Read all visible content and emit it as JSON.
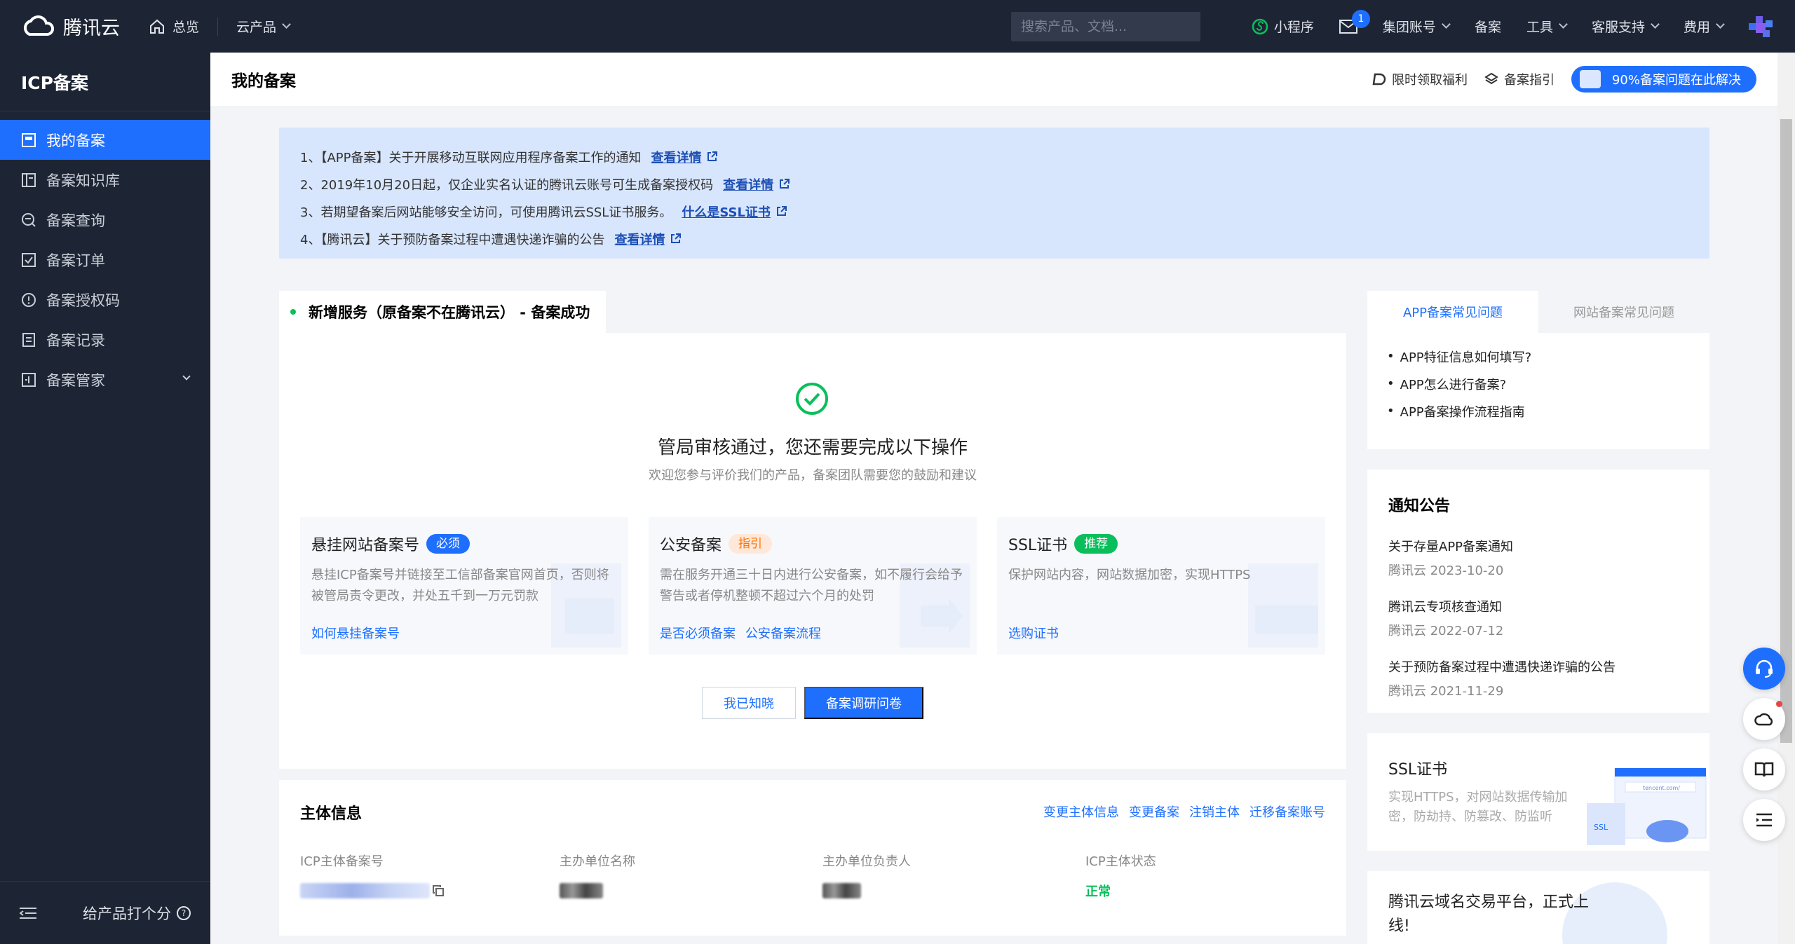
{
  "topbar": {
    "brand": "腾讯云",
    "overview": "总览",
    "products": "云产品",
    "search_placeholder": "搜索产品、文档...",
    "mini_program": "小程序",
    "mail_badge": "1",
    "group_account": "集团账号",
    "beian": "备案",
    "tools": "工具",
    "support": "客服支持",
    "billing": "费用"
  },
  "sidebar": {
    "title": "ICP备案",
    "items": [
      {
        "label": "我的备案",
        "icon": "my-beian-icon"
      },
      {
        "label": "备案知识库",
        "icon": "knowledge-icon"
      },
      {
        "label": "备案查询",
        "icon": "query-icon"
      },
      {
        "label": "备案订单",
        "icon": "order-icon"
      },
      {
        "label": "备案授权码",
        "icon": "auth-code-icon"
      },
      {
        "label": "备案记录",
        "icon": "record-icon"
      },
      {
        "label": "备案管家",
        "icon": "manager-icon"
      }
    ],
    "footer_rate": "给产品打个分",
    "footer_rate_icon": "?"
  },
  "header": {
    "title": "我的备案",
    "link_benefit": "限时领取福利",
    "link_guide": "备案指引",
    "promo": "90%备案问题在此解决"
  },
  "notice": {
    "lines": [
      {
        "text": "1、【APP备案】关于开展移动互联网应用程序备案工作的通知",
        "link": "查看详情"
      },
      {
        "text": "2、2019年10月20日起，仅企业实名认证的腾讯云账号可生成备案授权码",
        "link": "查看详情"
      },
      {
        "text": "3、若期望备案后网站能够安全访问，可使用腾讯云SSL证书服务。",
        "link": "什么是SSL证书"
      },
      {
        "text": "4、【腾讯云】关于预防备案过程中遭遇快递诈骗的公告",
        "link": "查看详情"
      }
    ]
  },
  "success": {
    "tab_title": "新增服务（原备案不在腾讯云） - 备案成功",
    "title": "管局审核通过，您还需要完成以下操作",
    "subtitle": "欢迎您参与评价我们的产品，备案团队需要您的鼓励和建议",
    "tasks": [
      {
        "title": "悬挂网站备案号",
        "tag": "必须",
        "desc": "悬挂ICP备案号并链接至工信部备案官网首页，否则将被管局责令更改，并处五千到一万元罚款",
        "links": [
          "如何悬挂备案号"
        ]
      },
      {
        "title": "公安备案",
        "tag": "指引",
        "desc": "需在服务开通三十日内进行公安备案，如不履行会给予警告或者停机整顿不超过六个月的处罚",
        "links": [
          "是否必须备案",
          "公安备案流程"
        ]
      },
      {
        "title": "SSL证书",
        "tag": "推荐",
        "desc": "保护网站内容，网站数据加密，实现HTTPS",
        "links": [
          "选购证书"
        ]
      }
    ],
    "btn_ack": "我已知晓",
    "btn_survey": "备案调研问卷"
  },
  "subject": {
    "title": "主体信息",
    "actions": [
      "变更主体信息",
      "变更备案",
      "注销主体",
      "迁移备案账号"
    ],
    "fields": [
      {
        "label": "ICP主体备案号"
      },
      {
        "label": "主办单位名称"
      },
      {
        "label": "主办单位负责人"
      },
      {
        "label": "ICP主体状态",
        "value": "正常"
      }
    ]
  },
  "faq": {
    "tab_app": "APP备案常见问题",
    "tab_web": "网站备案常见问题",
    "items": [
      "APP特征信息如何填写?",
      "APP怎么进行备案?",
      "APP备案操作流程指南"
    ]
  },
  "announcements": {
    "title": "通知公告",
    "items": [
      {
        "title": "关于存量APP备案通知",
        "meta": "腾讯云 2023-10-20"
      },
      {
        "title": "腾讯云专项核查通知",
        "meta": "腾讯云 2022-07-12"
      },
      {
        "title": "关于预防备案过程中遭遇快递诈骗的公告",
        "meta": "腾讯云 2021-11-29"
      }
    ]
  },
  "ssl_promo": {
    "title": "SSL证书",
    "desc": "实现HTTPS，对网站数据传输加密，防劫持、防篡改、防监听",
    "art_url": "tencent.com/",
    "art_label": "SSL"
  },
  "domain_promo": {
    "title": "腾讯云域名交易平台，正式上线!"
  },
  "colors": {
    "primary": "#1f6fff",
    "nav_bg": "#1d2535",
    "success": "#0abf5b",
    "notice_bg": "#d8e6fd"
  }
}
